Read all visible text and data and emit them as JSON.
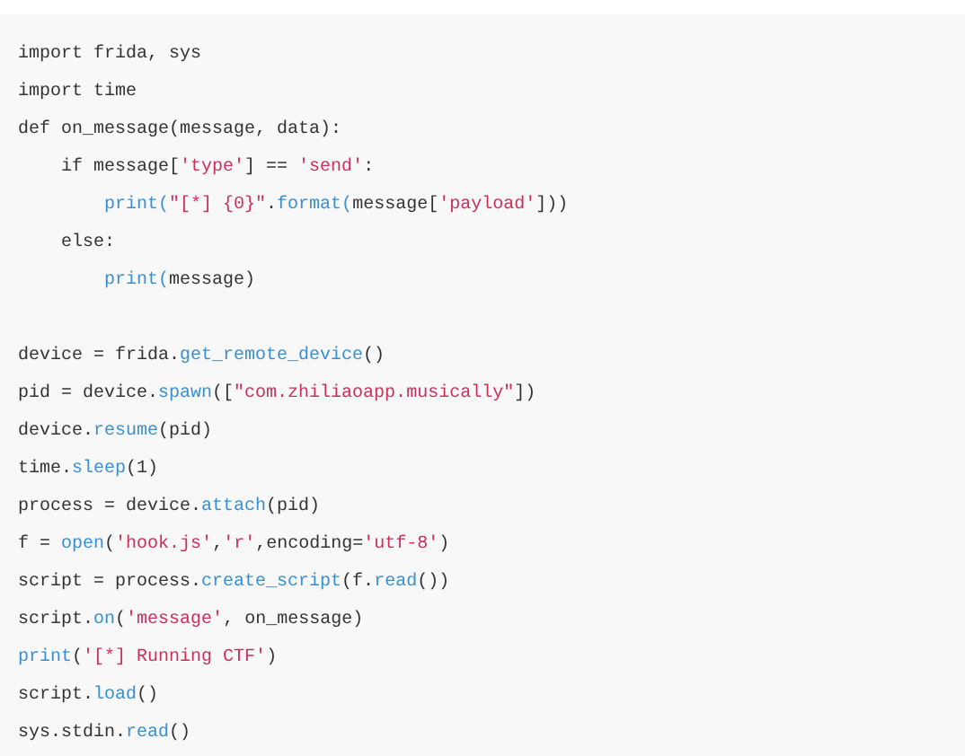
{
  "code_block": {
    "lines": [
      {
        "kind": "code",
        "tokens": [
          {
            "kind": "plain",
            "text": "import frida, sys"
          }
        ]
      },
      {
        "kind": "code",
        "tokens": [
          {
            "kind": "plain",
            "text": "import time"
          }
        ]
      },
      {
        "kind": "code",
        "tokens": [
          {
            "kind": "plain",
            "text": "def on_message(message, data):"
          }
        ]
      },
      {
        "kind": "code",
        "tokens": [
          {
            "kind": "plain",
            "text": "    if message["
          },
          {
            "kind": "string",
            "text": "'type'"
          },
          {
            "kind": "plain",
            "text": "] == "
          },
          {
            "kind": "string",
            "text": "'send'"
          },
          {
            "kind": "plain",
            "text": ":"
          }
        ]
      },
      {
        "kind": "code",
        "tokens": [
          {
            "kind": "function",
            "text": "        print("
          },
          {
            "kind": "string",
            "text": "\"[*] {0}\""
          },
          {
            "kind": "plain",
            "text": "."
          },
          {
            "kind": "function",
            "text": "format("
          },
          {
            "kind": "plain",
            "text": "message["
          },
          {
            "kind": "string",
            "text": "'payload'"
          },
          {
            "kind": "plain",
            "text": "]))"
          }
        ]
      },
      {
        "kind": "code",
        "tokens": [
          {
            "kind": "plain",
            "text": "    else:"
          }
        ]
      },
      {
        "kind": "code",
        "tokens": [
          {
            "kind": "function",
            "text": "        print("
          },
          {
            "kind": "plain",
            "text": "message)"
          }
        ]
      },
      {
        "kind": "blank"
      },
      {
        "kind": "code",
        "tokens": [
          {
            "kind": "plain",
            "text": "device = frida."
          },
          {
            "kind": "function",
            "text": "get_remote_device"
          },
          {
            "kind": "plain",
            "text": "()"
          }
        ]
      },
      {
        "kind": "code",
        "tokens": [
          {
            "kind": "plain",
            "text": "pid = device."
          },
          {
            "kind": "function",
            "text": "spawn"
          },
          {
            "kind": "plain",
            "text": "(["
          },
          {
            "kind": "string",
            "text": "\"com.zhiliaoapp.musically\""
          },
          {
            "kind": "plain",
            "text": "])"
          }
        ]
      },
      {
        "kind": "code",
        "tokens": [
          {
            "kind": "plain",
            "text": "device."
          },
          {
            "kind": "function",
            "text": "resume"
          },
          {
            "kind": "plain",
            "text": "(pid)"
          }
        ]
      },
      {
        "kind": "code",
        "tokens": [
          {
            "kind": "plain",
            "text": "time."
          },
          {
            "kind": "function",
            "text": "sleep"
          },
          {
            "kind": "plain",
            "text": "(1)"
          }
        ]
      },
      {
        "kind": "code",
        "tokens": [
          {
            "kind": "plain",
            "text": "process = device."
          },
          {
            "kind": "function",
            "text": "attach"
          },
          {
            "kind": "plain",
            "text": "(pid)"
          }
        ]
      },
      {
        "kind": "code",
        "tokens": [
          {
            "kind": "plain",
            "text": "f = "
          },
          {
            "kind": "function",
            "text": "open"
          },
          {
            "kind": "plain",
            "text": "("
          },
          {
            "kind": "string",
            "text": "'hook.js'"
          },
          {
            "kind": "plain",
            "text": ","
          },
          {
            "kind": "string",
            "text": "'r'"
          },
          {
            "kind": "plain",
            "text": ",encoding="
          },
          {
            "kind": "string",
            "text": "'utf-8'"
          },
          {
            "kind": "plain",
            "text": ")"
          }
        ]
      },
      {
        "kind": "code",
        "tokens": [
          {
            "kind": "plain",
            "text": "script = process."
          },
          {
            "kind": "function",
            "text": "create_script"
          },
          {
            "kind": "plain",
            "text": "(f."
          },
          {
            "kind": "function",
            "text": "read"
          },
          {
            "kind": "plain",
            "text": "())"
          }
        ]
      },
      {
        "kind": "code",
        "tokens": [
          {
            "kind": "plain",
            "text": "script."
          },
          {
            "kind": "function",
            "text": "on"
          },
          {
            "kind": "plain",
            "text": "("
          },
          {
            "kind": "string",
            "text": "'message'"
          },
          {
            "kind": "plain",
            "text": ", on_message)"
          }
        ]
      },
      {
        "kind": "code",
        "tokens": [
          {
            "kind": "function",
            "text": "print"
          },
          {
            "kind": "plain",
            "text": "("
          },
          {
            "kind": "string",
            "text": "'[*] Running CTF'"
          },
          {
            "kind": "plain",
            "text": ")"
          }
        ]
      },
      {
        "kind": "code",
        "tokens": [
          {
            "kind": "plain",
            "text": "script."
          },
          {
            "kind": "function",
            "text": "load"
          },
          {
            "kind": "plain",
            "text": "()"
          }
        ]
      },
      {
        "kind": "code",
        "tokens": [
          {
            "kind": "plain",
            "text": "sys.stdin."
          },
          {
            "kind": "function",
            "text": "read"
          },
          {
            "kind": "plain",
            "text": "()"
          }
        ]
      }
    ]
  }
}
